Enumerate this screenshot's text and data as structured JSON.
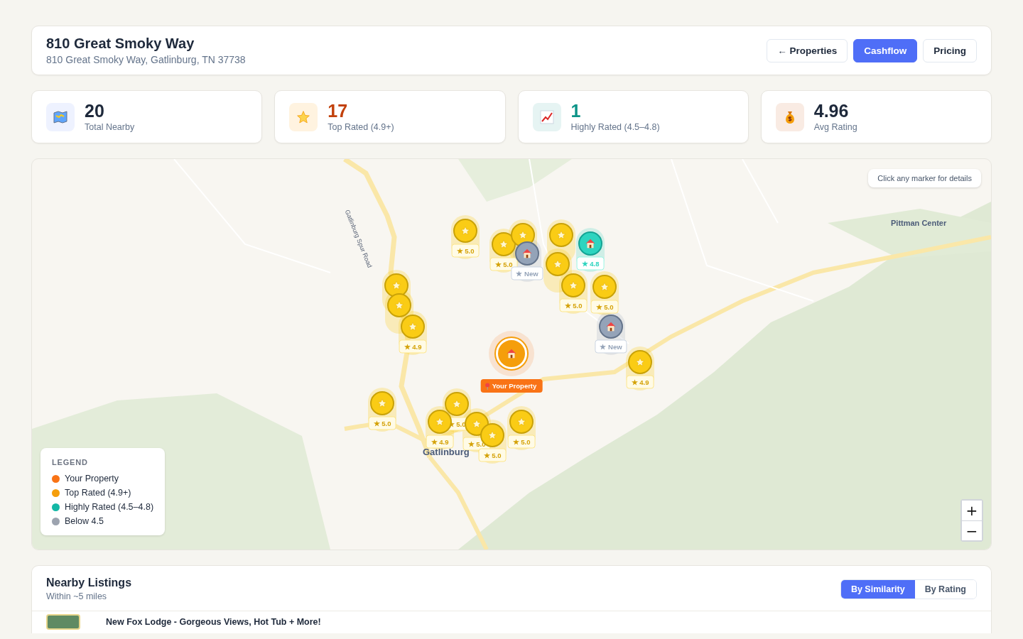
{
  "header": {
    "title": "810 Great Smoky Way",
    "address": "810 Great Smoky Way, Gatlinburg, TN 37738",
    "buttons": [
      {
        "label": "← Properties",
        "selected": false
      },
      {
        "label": "Cashflow",
        "selected": true
      },
      {
        "label": "Pricing",
        "selected": false
      }
    ]
  },
  "stats": [
    {
      "kind": "map",
      "value": "20",
      "label": "Total Nearby"
    },
    {
      "kind": "star",
      "value": "17",
      "label": "Top Rated (4.9+)"
    },
    {
      "kind": "chart",
      "value": "1",
      "label": "Highly Rated (4.5–4.8)"
    },
    {
      "kind": "money",
      "value": "4.96",
      "label": "Avg Rating"
    }
  ],
  "map": {
    "hint": "Click any marker for details",
    "places": [
      "Pittman Center",
      "Gatlinburg",
      "Gatlinburg Spur Road"
    ],
    "property": {
      "label": "Your Property"
    },
    "markers": [
      {
        "kind": "top",
        "rating": "★ 5.0"
      },
      {
        "kind": "top",
        "rating": "★ 5.0"
      },
      {
        "kind": "top"
      },
      {
        "kind": "low",
        "rating": "★ New"
      },
      {
        "kind": "top"
      },
      {
        "kind": "high",
        "rating": "★ 4.8"
      },
      {
        "kind": "top"
      },
      {
        "kind": "top",
        "rating": "★ 5.0"
      },
      {
        "kind": "top",
        "rating": "★ 5.0"
      },
      {
        "kind": "low",
        "rating": "★ New"
      },
      {
        "kind": "top"
      },
      {
        "kind": "top"
      },
      {
        "kind": "top",
        "rating": "★ 4.9"
      },
      {
        "kind": "top",
        "rating": "★ 4.9"
      },
      {
        "kind": "top",
        "rating": "★ 5.0"
      },
      {
        "kind": "top",
        "rating": "★ 5.0"
      },
      {
        "kind": "top",
        "rating": "★ 4.9"
      },
      {
        "kind": "top",
        "rating": "★ 5.0"
      },
      {
        "kind": "top",
        "rating": "★ 5.0"
      },
      {
        "kind": "top",
        "rating": "★ 5.0"
      }
    ],
    "legend": {
      "title": "LEGEND",
      "items": [
        {
          "label": "Your Property",
          "color": "#f97316"
        },
        {
          "label": "Top Rated (4.9+)",
          "color": "#f59e0b"
        },
        {
          "label": "Highly Rated (4.5–4.8)",
          "color": "#14b8a6"
        },
        {
          "label": "Below 4.5",
          "color": "#9ca3af"
        }
      ]
    },
    "zoom": [
      "+",
      "−"
    ]
  },
  "listings": {
    "title": "Nearby Listings",
    "subtitle": "Within ~5 miles",
    "sort": [
      {
        "label": "By Similarity",
        "selected": true
      },
      {
        "label": "By Rating",
        "selected": false
      }
    ],
    "rows": [
      {
        "title": "New Fox Lodge - Gorgeous Views, Hot Tub + More!"
      }
    ]
  }
}
